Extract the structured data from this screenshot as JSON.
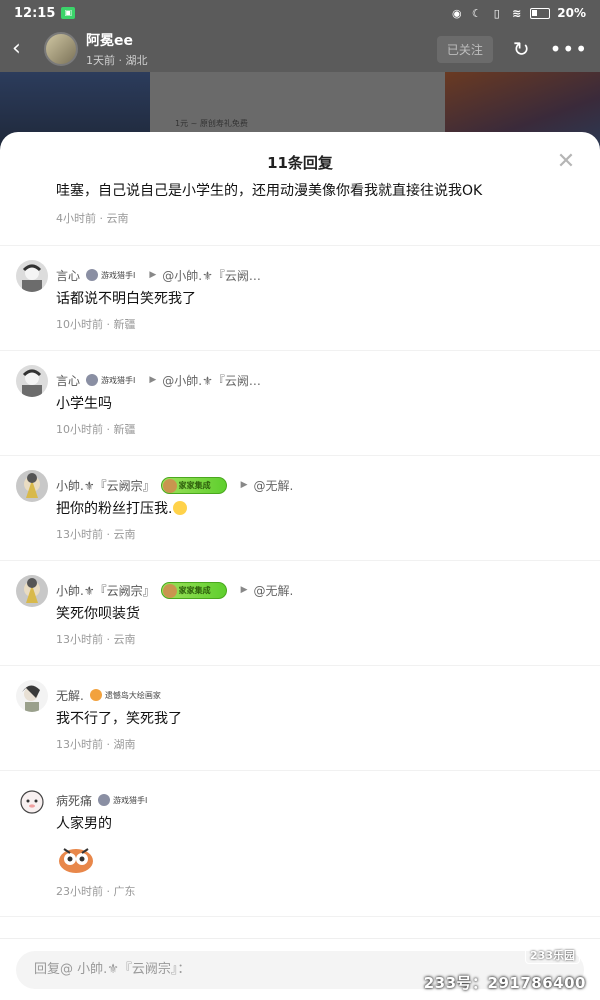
{
  "status_bar": {
    "time": "12:15",
    "battery": "20%"
  },
  "header": {
    "back": "‹",
    "user_name": "阿冕ee",
    "user_meta": "1天前 · 湖北",
    "follow_label": "已关注"
  },
  "background": {
    "caption": "1元 ~ 原创寿礼免费"
  },
  "sheet": {
    "title": "11条回复"
  },
  "comments": [
    {
      "user": "",
      "text": "哇塞，自己说自己是小学生的，还用动漫美像你看我就直接往说我OK",
      "meta": "4小时前 · 云南",
      "partial": true
    },
    {
      "user": "言心",
      "badge": "游戏猎手Ⅰ",
      "reply_to": "@小帥.⚜『云阙…",
      "text": "话都说不明白笑死我了",
      "meta": "10小时前 · 新疆"
    },
    {
      "user": "言心",
      "badge": "游戏猎手Ⅰ",
      "reply_to": "@小帥.⚜『云阙…",
      "text": "小学生吗",
      "meta": "10小时前 · 新疆"
    },
    {
      "user": "小帥.⚜『云阙宗』",
      "badge_green": "家家集成",
      "reply_to": "@无解.",
      "text": "把你的粉丝打压我.",
      "meta": "13小时前 · 云南",
      "has_emoji": true
    },
    {
      "user": "小帥.⚜『云阙宗』",
      "badge_green": "家家集成",
      "reply_to": "@无解.",
      "text": "笑死你呗装货",
      "meta": "13小时前 · 云南"
    },
    {
      "user": "无解.",
      "badge": "遗憾岛大绘画家",
      "text": "我不行了，笑死我了",
      "meta": "13小时前 · 湖南"
    },
    {
      "user": "病死痛",
      "badge": "游戏猎手Ⅰ",
      "text": "人家男的",
      "meta": "23小时前 · 广东",
      "has_sticker": true
    }
  ],
  "input": {
    "placeholder": "回复@ 小帥.⚜『云阙宗』："
  },
  "watermark": {
    "logo": "233乐园",
    "text": "233号：291786400"
  },
  "colors": {
    "accent_green": "#5fcf2e",
    "sheet_bg": "#ffffff",
    "overlay": "#4a4a4a"
  }
}
